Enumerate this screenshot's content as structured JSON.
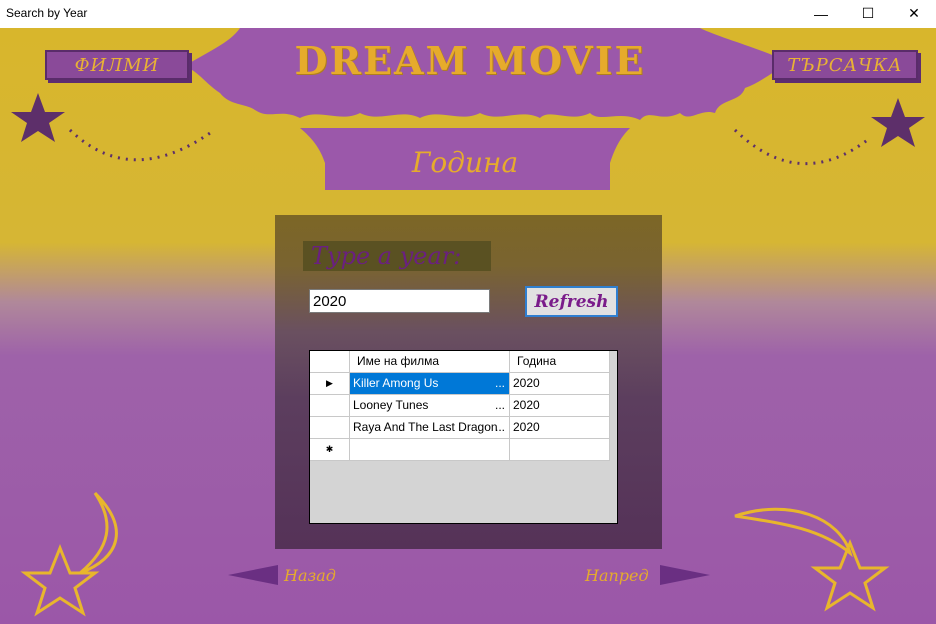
{
  "window": {
    "title": "Search by Year",
    "minimize_glyph": "—",
    "maximize_glyph": "☐",
    "close_glyph": "✕"
  },
  "header": {
    "left_tab": "ФИЛМИ",
    "right_tab": "ТЪРСАЧКА",
    "brand_title": "DREAM MOVIE",
    "brand_subtitle": "Година"
  },
  "search": {
    "prompt": "Type a year:",
    "input_value": "2020",
    "refresh_label": "Refresh"
  },
  "grid": {
    "columns": [
      "Име на филма",
      "Година"
    ],
    "rows": [
      {
        "name": "Killer Among Us",
        "year": "2020",
        "selected": true
      },
      {
        "name": "Looney Tunes",
        "year": "2020",
        "selected": false
      },
      {
        "name": "Raya And The Last Dragon",
        "year": "2020",
        "selected": false
      }
    ],
    "current_row_glyph": "▶",
    "new_row_glyph": "✱",
    "ellipsis": "..."
  },
  "footer": {
    "back_label": "Назад",
    "next_label": "Напред"
  },
  "colors": {
    "gold": "#e6ab2c",
    "purple": "#8a4a99",
    "dark_purple": "#5a2c6a",
    "selection": "#0078d7"
  }
}
